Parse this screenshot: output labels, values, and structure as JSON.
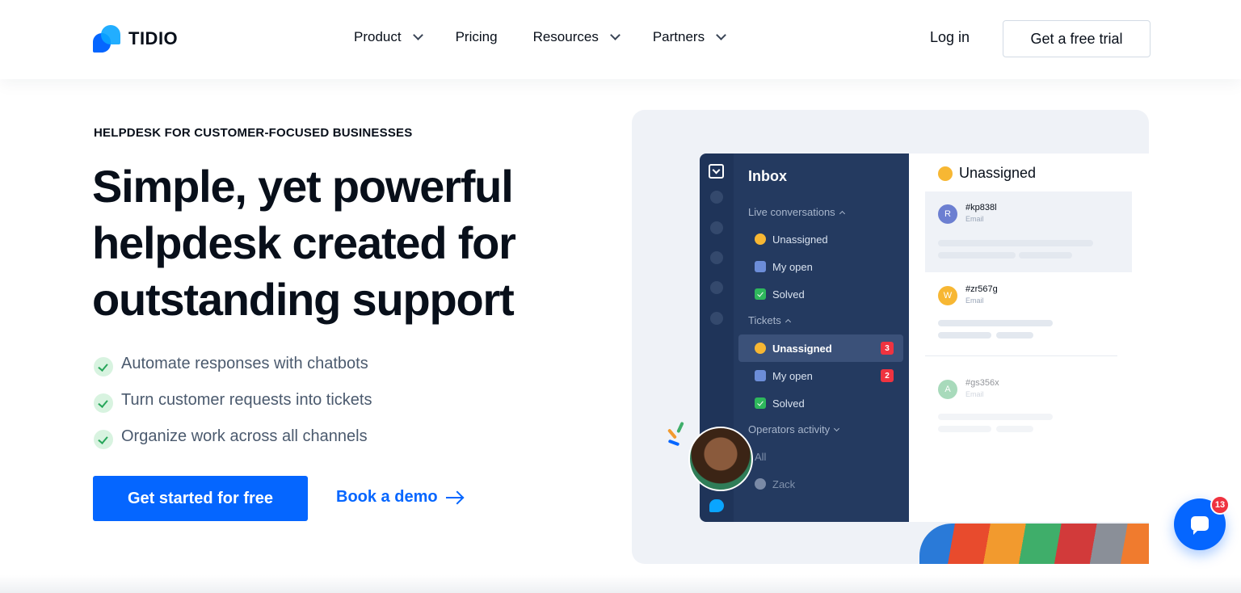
{
  "brand": {
    "name": "TIDIO"
  },
  "nav": {
    "items": [
      {
        "label": "Product",
        "has_dropdown": true
      },
      {
        "label": "Pricing",
        "has_dropdown": false
      },
      {
        "label": "Resources",
        "has_dropdown": true
      },
      {
        "label": "Partners",
        "has_dropdown": true
      }
    ],
    "login": "Log in",
    "trial": "Get a free trial"
  },
  "hero": {
    "eyebrow": "HELPDESK FOR CUSTOMER-FOCUSED BUSINESSES",
    "title": "Simple, yet powerful helpdesk created for outstanding support",
    "features": [
      "Automate responses with chatbots",
      "Turn customer requests into tickets",
      "Organize work across all channels"
    ],
    "primary_cta": "Get started for free",
    "secondary_cta": "Book a demo"
  },
  "mockup": {
    "inbox_title": "Inbox",
    "live_section": "Live conversations",
    "live_items": [
      {
        "label": "Unassigned",
        "icon": "wave-icon"
      },
      {
        "label": "My open",
        "icon": "people-icon"
      },
      {
        "label": "Solved",
        "icon": "check-icon"
      }
    ],
    "tickets_section": "Tickets",
    "ticket_items": [
      {
        "label": "Unassigned",
        "icon": "wave-icon",
        "badge": "3"
      },
      {
        "label": "My open",
        "icon": "people-icon",
        "badge": "2"
      },
      {
        "label": "Solved",
        "icon": "check-icon"
      }
    ],
    "operators_section": "Operators activity",
    "operator_items": [
      "All",
      "Zack"
    ],
    "list_title": "Unassigned",
    "conversations": [
      {
        "initial": "R",
        "id": "#kp838l",
        "channel": "Email",
        "color": "#6c7fd1"
      },
      {
        "initial": "W",
        "id": "#zr567g",
        "channel": "Email",
        "color": "#f7b733"
      },
      {
        "initial": "A",
        "id": "#gs356x",
        "channel": "Email",
        "color": "#3fae6a"
      }
    ]
  },
  "chat_widget": {
    "badge": "13"
  },
  "colors": {
    "accent": "#0566ff",
    "sidebar": "#243a60",
    "badge": "#ef3340"
  }
}
